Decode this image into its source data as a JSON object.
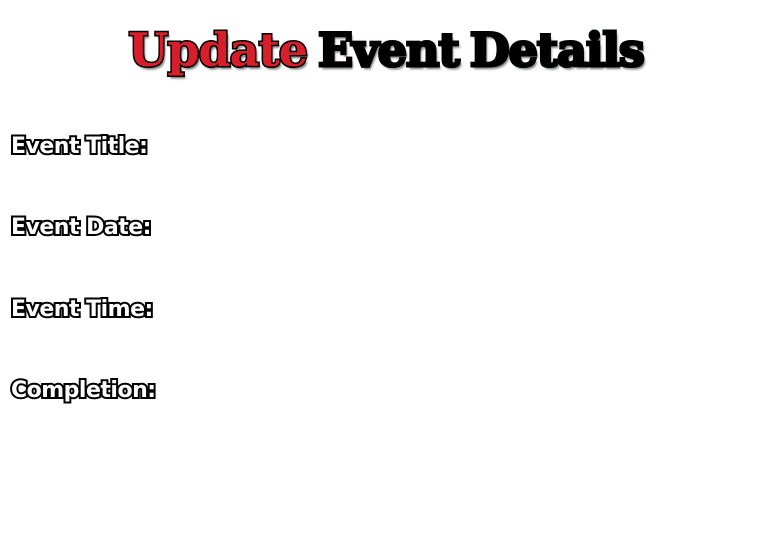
{
  "form": {
    "title_parts": [
      "Update",
      "Event",
      "Details"
    ],
    "fields": [
      {
        "label": "Event Title:"
      },
      {
        "label": "Event Date:"
      },
      {
        "label": "Event Time:"
      },
      {
        "label": "Completion:"
      }
    ]
  },
  "colors": {
    "title_update": "#d81e2b",
    "title_event_start": "#c83a43",
    "title_event_end": "#7fa59e",
    "title_details": "#55e3db",
    "label_text": "#ffffff",
    "label_outline": "#000000",
    "background": "#ffffff"
  }
}
